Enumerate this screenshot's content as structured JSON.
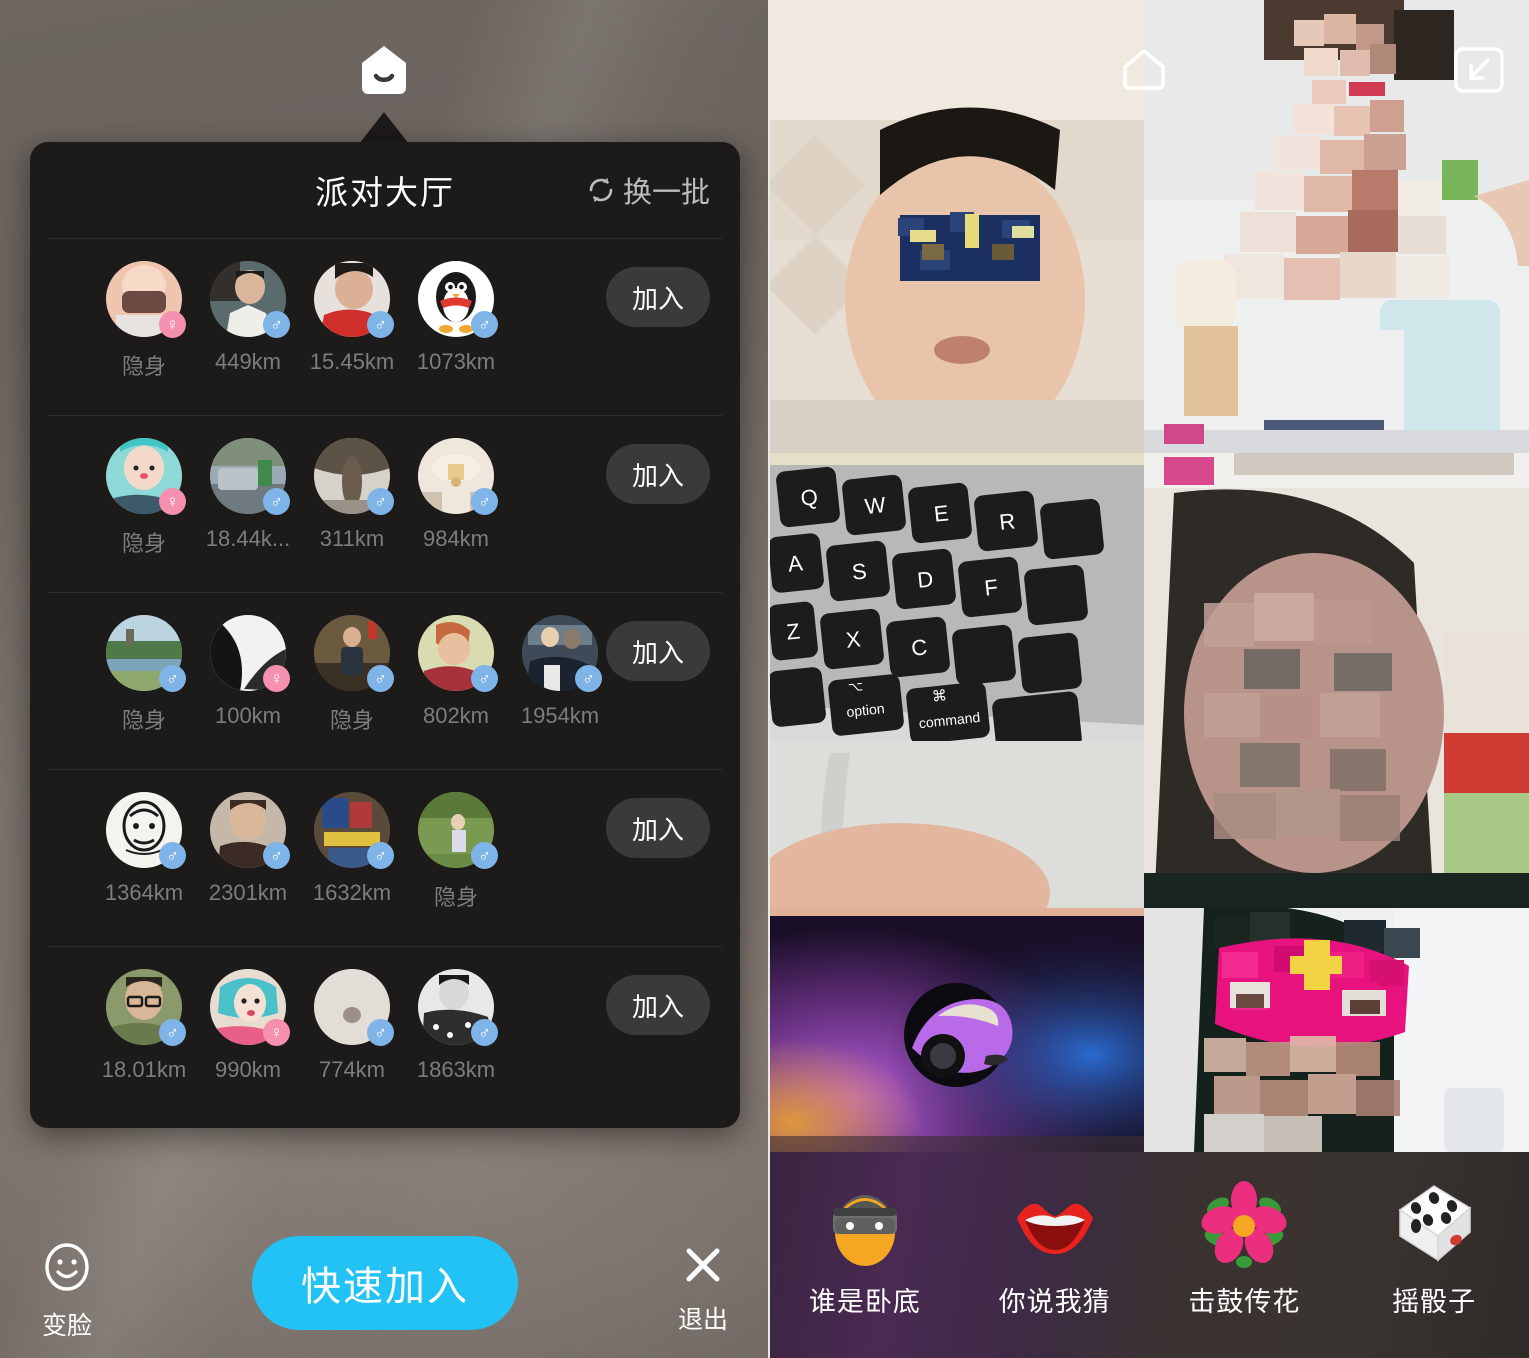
{
  "left": {
    "home_icon": "house-smile-icon",
    "card": {
      "title": "派对大厅",
      "refresh_label": "换一批",
      "refresh_icon": "refresh-circle-icon",
      "join_label": "加入",
      "rows": [
        {
          "join_label": "加入",
          "members": [
            {
              "distance": "隐身",
              "gender": "f",
              "gender_symbol": "♀",
              "avatar": "person-mask-pink"
            },
            {
              "distance": "449km",
              "gender": "m",
              "gender_symbol": "♂",
              "avatar": "man-white-shirt"
            },
            {
              "distance": "15.45km",
              "gender": "m",
              "gender_symbol": "♂",
              "avatar": "man-red-polo"
            },
            {
              "distance": "1073km",
              "gender": "m",
              "gender_symbol": "♂",
              "avatar": "qq-penguin"
            }
          ]
        },
        {
          "join_label": "加入",
          "members": [
            {
              "distance": "隐身",
              "gender": "f",
              "gender_symbol": "♀",
              "avatar": "woman-cat-filter"
            },
            {
              "distance": "18.44k...",
              "gender": "m",
              "gender_symbol": "♂",
              "avatar": "street-car-scene"
            },
            {
              "distance": "311km",
              "gender": "m",
              "gender_symbol": "♂",
              "avatar": "rock-landscape"
            },
            {
              "distance": "984km",
              "gender": "m",
              "gender_symbol": "♂",
              "avatar": "chandelier-room"
            }
          ]
        },
        {
          "join_label": "加入",
          "members": [
            {
              "distance": "隐身",
              "gender": "m",
              "gender_symbol": "♂",
              "avatar": "riverside-park"
            },
            {
              "distance": "100km",
              "gender": "f",
              "gender_symbol": "♀",
              "avatar": "bw-abstract"
            },
            {
              "distance": "隐身",
              "gender": "m",
              "gender_symbol": "♂",
              "avatar": "man-standing-phone"
            },
            {
              "distance": "802km",
              "gender": "m",
              "gender_symbol": "♂",
              "avatar": "couple-red-portrait"
            },
            {
              "distance": "1954km",
              "gender": "m",
              "gender_symbol": "♂",
              "avatar": "couple-photo"
            }
          ]
        },
        {
          "join_label": "加入",
          "members": [
            {
              "distance": "1364km",
              "gender": "m",
              "gender_symbol": "♂",
              "avatar": "sketch-face"
            },
            {
              "distance": "2301km",
              "gender": "m",
              "gender_symbol": "♂",
              "avatar": "young-man-dark"
            },
            {
              "distance": "1632km",
              "gender": "m",
              "gender_symbol": "♂",
              "avatar": "colorful-figure"
            },
            {
              "distance": "隐身",
              "gender": "m",
              "gender_symbol": "♂",
              "avatar": "garden-walk"
            }
          ]
        },
        {
          "join_label": "加入",
          "members": [
            {
              "distance": "18.01km",
              "gender": "m",
              "gender_symbol": "♂",
              "avatar": "man-glasses"
            },
            {
              "distance": "990km",
              "gender": "f",
              "gender_symbol": "♀",
              "avatar": "woman-teal-hair"
            },
            {
              "distance": "774km",
              "gender": "m",
              "gender_symbol": "♂",
              "avatar": "blank-gray"
            },
            {
              "distance": "1863km",
              "gender": "m",
              "gender_symbol": "♂",
              "avatar": "bw-man-pattern"
            }
          ]
        }
      ]
    },
    "actions": {
      "face_label": "变脸",
      "face_icon": "smiley-face-icon",
      "quick_join_label": "快速加入",
      "exit_label": "退出",
      "exit_icon": "close-x-icon"
    }
  },
  "right": {
    "home_icon": "house-outline-icon",
    "collapse_icon": "collapse-arrow-icon",
    "tiles": [
      {
        "name": "masked-man-bed"
      },
      {
        "name": "woman-pixelated-white"
      },
      {
        "name": "macbook-keyboard"
      },
      {
        "name": "man-blurred-face"
      },
      {
        "name": "purple-car-avatar"
      },
      {
        "name": "pink-mask-person"
      }
    ],
    "games": [
      {
        "label": "谁是卧底",
        "icon": "spy-face-icon"
      },
      {
        "label": "你说我猜",
        "icon": "lips-icon"
      },
      {
        "label": "击鼓传花",
        "icon": "flower-icon"
      },
      {
        "label": "摇骰子",
        "icon": "dice-icon"
      }
    ]
  },
  "colors": {
    "accent": "#22c2f5",
    "male_badge": "#7fb4e8",
    "female_badge": "#f591ae",
    "card_bg": "#1c1b1a",
    "join_btn": "#3b3a39"
  }
}
